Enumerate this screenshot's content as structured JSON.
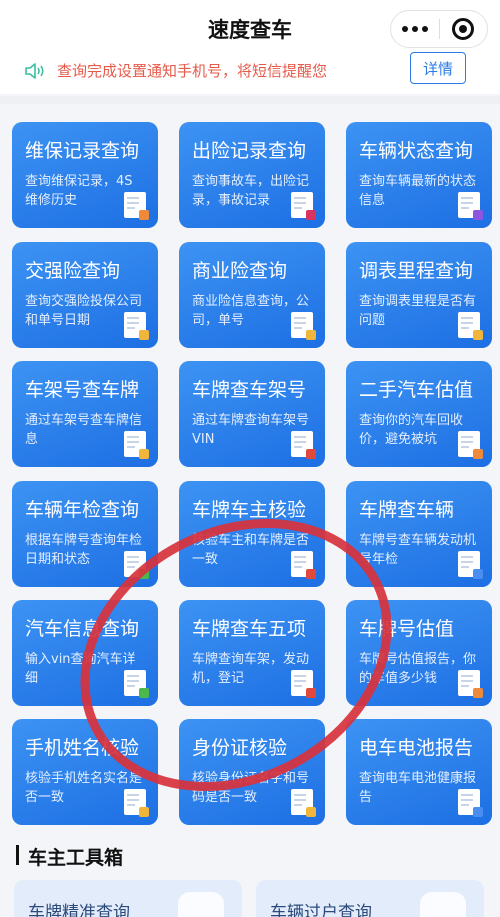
{
  "header": {
    "title": "速度查车"
  },
  "notice": {
    "text": "查询完成设置通知手机号，将短信提醒您",
    "detail_label": "详情"
  },
  "cards": [
    {
      "title": "维保记录查询",
      "desc": "查询维保记录，4S维修历史",
      "chip": "#f08a3b"
    },
    {
      "title": "出险记录查询",
      "desc": "查询事故车，出险记录，事故记录",
      "chip": "#d8345f"
    },
    {
      "title": "车辆状态查询",
      "desc": "查询车辆最新的状态信息",
      "chip": "#8f55e0"
    },
    {
      "title": "交强险查询",
      "desc": "查询交强险投保公司和单号日期",
      "chip": "#f0b63b"
    },
    {
      "title": "商业险查询",
      "desc": "商业险信息查询，公司，单号",
      "chip": "#f0b63b"
    },
    {
      "title": "调表里程查询",
      "desc": "查询调表里程是否有问题",
      "chip": "#f0b63b"
    },
    {
      "title": "车架号查车牌",
      "desc": "通过车架号查车牌信息",
      "chip": "#f0b63b"
    },
    {
      "title": "车牌查车架号",
      "desc": "通过车牌查询车架号VIN",
      "chip": "#e0493b"
    },
    {
      "title": "二手汽车估值",
      "desc": "查询你的汽车回收价，避免被坑",
      "chip": "#f08a3b"
    },
    {
      "title": "车辆年检查询",
      "desc": "根据车牌号查询年检日期和状态",
      "chip": "#4cb84c"
    },
    {
      "title": "车牌车主核验",
      "desc": "核验车主和车牌是否一致",
      "chip": "#e0493b"
    },
    {
      "title": "车牌查车辆",
      "desc": "车牌号查车辆发动机号年检",
      "chip": "#4a8ef0"
    },
    {
      "title": "汽车信息查询",
      "desc": "输入vin查询汽车详细",
      "chip": "#4cb84c"
    },
    {
      "title": "车牌查车五项",
      "desc": "车牌查询车架，发动机，登记",
      "chip": "#e0493b"
    },
    {
      "title": "车牌号估值",
      "desc": "车牌号估值报告，你的车值多少钱",
      "chip": "#f08a3b"
    },
    {
      "title": "手机姓名核验",
      "desc": "核验手机姓名实名是否一致",
      "chip": "#f0b63b"
    },
    {
      "title": "身份证核验",
      "desc": "核验身份证名字和号码是否一致",
      "chip": "#f0b63b"
    },
    {
      "title": "电车电池报告",
      "desc": "查询电车电池健康报告",
      "chip": "#4a8ef0"
    }
  ],
  "toolbox": {
    "title": "车主工具箱",
    "items": [
      {
        "label": "车牌精准查询"
      },
      {
        "label": "车辆过户查询"
      }
    ]
  },
  "colors": {
    "card_blue": "#2b80ee",
    "notice_red": "#e65a4a",
    "annotation_circle": "#d8323c"
  }
}
